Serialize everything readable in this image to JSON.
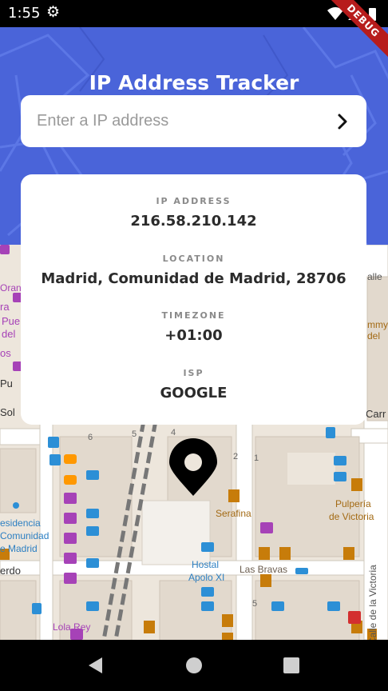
{
  "status_bar": {
    "time": "1:55",
    "debug_banner": "DEBUG",
    "icons": [
      "settings-icon",
      "wifi-icon",
      "signal-icon",
      "battery-icon"
    ]
  },
  "app": {
    "title": "IP Address Tracker",
    "header_color": "#4a64d9"
  },
  "search": {
    "placeholder": "Enter a IP address",
    "value": "",
    "submit_icon": "chevron-right-icon"
  },
  "info": {
    "ip_label": "IP ADDRESS",
    "ip_value": "216.58.210.142",
    "location_label": "LOCATION",
    "location_value": "Madrid, Comunidad de Madrid, 28706",
    "timezone_label": "TIMEZONE",
    "timezone_value": "+01:00",
    "isp_label": "ISP",
    "isp_value": "GOOGLE"
  },
  "map": {
    "marker_icon": "location-pin-icon",
    "labels": {
      "serafina": "Serafina",
      "hostal": "Hostal",
      "apolo": "Apolo XI",
      "bravas": "Las Bravas",
      "pulperia": "Pulpería",
      "victoria": "de Victoria",
      "calle_victoria": "Calle de la Victoria",
      "lola": "Lola Rey",
      "residencia": "esidencia",
      "comunidad": "Comunidad",
      "madrid": "e Madrid",
      "sol": "Sol",
      "carr": "Carr",
      "erdo": "erdo",
      "puer": "Pue",
      "del": "del",
      "os": "os",
      "ra": "ra",
      "pu": "Pu",
      "oran": "Oran",
      "calle_right": "alle",
      "mmy": "mmy",
      "del_right": "del",
      "num6": "6",
      "num5": "5",
      "num4": "4",
      "num2": "2",
      "num1": "1",
      "num5b": "5"
    }
  },
  "nav_bar": {
    "back_icon": "back-triangle-icon",
    "home_icon": "home-circle-icon",
    "recents_icon": "recents-square-icon"
  }
}
